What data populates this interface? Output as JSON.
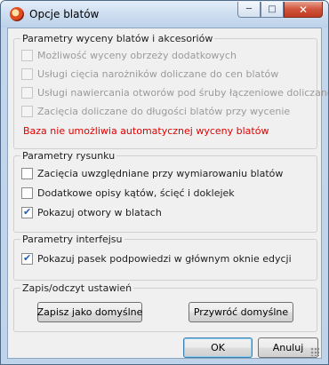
{
  "window": {
    "title": "Opcje blatów"
  },
  "titlebar_buttons": {
    "minimize_icon": "minimize-icon",
    "maximize_icon": "maximize-icon",
    "close_icon": "close-icon"
  },
  "groups": {
    "pricing": {
      "legend": "Parametry wyceny blatów i akcesoriów",
      "options": [
        {
          "label": "Możliwość wyceny obrzeży dodatkowych",
          "checked": false,
          "disabled": true
        },
        {
          "label": "Usługi cięcia narożników doliczane do cen blatów",
          "checked": false,
          "disabled": true
        },
        {
          "label": "Usługi nawiercania otworów pod śruby łączeniowe doliczane do cen blatów",
          "checked": false,
          "disabled": true
        },
        {
          "label": "Zacięcia doliczane do długości blatów przy wycenie",
          "checked": false,
          "disabled": true
        }
      ],
      "warning": "Baza nie umożliwia automatycznej wyceny blatów",
      "warning_color": "#e00000"
    },
    "drawing": {
      "legend": "Parametry rysunku",
      "options": [
        {
          "label": "Zacięcia uwzględniane przy wymiarowaniu blatów",
          "checked": false,
          "disabled": false
        },
        {
          "label": "Dodatkowe opisy kątów, ścięć i doklejek",
          "checked": false,
          "disabled": false
        },
        {
          "label": "Pokazuj otwory w blatach",
          "checked": true,
          "disabled": false
        }
      ]
    },
    "interface": {
      "legend": "Parametry interfejsu",
      "options": [
        {
          "label": "Pokazuj pasek podpowiedzi w głównym oknie edycji",
          "checked": true,
          "disabled": false
        }
      ]
    },
    "settings": {
      "legend": "Zapis/odczyt ustawień",
      "save_default": "Zapisz jako domyślne",
      "restore_default": "Przywróć domyślne"
    }
  },
  "footer": {
    "ok": "OK",
    "cancel": "Anuluj"
  }
}
